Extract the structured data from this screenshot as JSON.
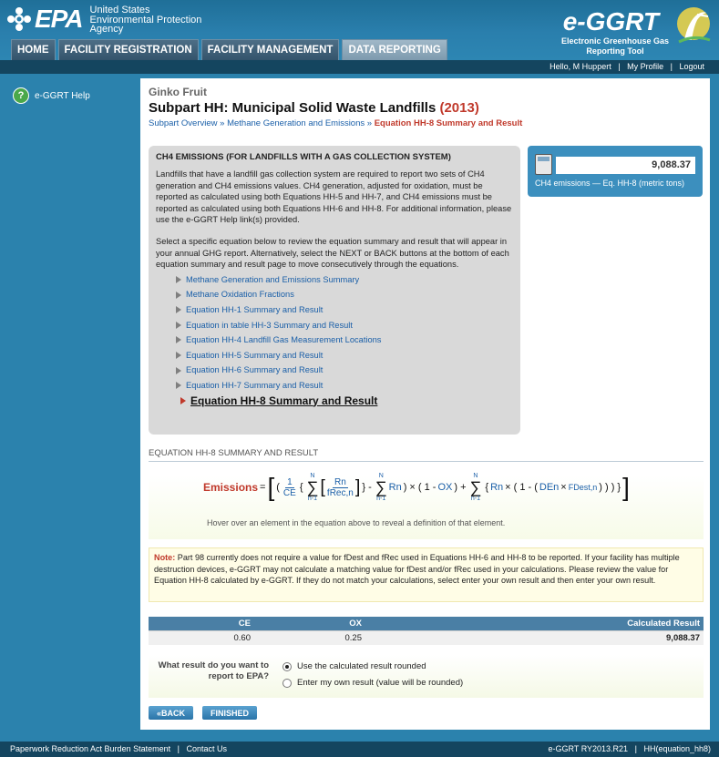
{
  "header": {
    "epa_word": "EPA",
    "epa_agency": [
      "United States",
      "Environmental Protection",
      "Agency"
    ],
    "eggrt_title": "e-GGRT",
    "eggrt_subtitle": [
      "Electronic Greenhouse Gas",
      "Reporting Tool"
    ]
  },
  "nav": {
    "tabs": [
      {
        "label": "HOME"
      },
      {
        "label": "FACILITY REGISTRATION"
      },
      {
        "label": "FACILITY MANAGEMENT"
      },
      {
        "label": "DATA REPORTING"
      }
    ]
  },
  "userbar": {
    "greeting": "Hello, M Huppert",
    "profile": "My Profile",
    "logout": "Logout"
  },
  "sidebar": {
    "help_label": "e-GGRT Help"
  },
  "page": {
    "facility": "Ginko Fruit",
    "title": "Subpart HH: Municipal Solid Waste Landfills",
    "year": "(2013)",
    "breadcrumb": {
      "item1": "Subpart Overview",
      "sep": "»",
      "item2": "Methane Generation and Emissions",
      "current": "Equation HH-8 Summary and Result"
    }
  },
  "info_box": {
    "heading": "CH4 EMISSIONS (FOR LANDFILLS WITH A GAS COLLECTION SYSTEM)",
    "para1": "Landfills that have a landfill gas collection system are required to report two sets of CH4 generation and CH4 emissions values. CH4 generation, adjusted for oxidation, must be reported as calculated using both Equations HH-5 and HH-7, and CH4 emissions must be reported as calculated using both Equations HH-6 and HH-8. For additional information, please use the e-GGRT Help link(s) provided.",
    "para2": "Select a specific equation below to review the equation summary and result that will appear in your annual GHG report. Alternatively, select the NEXT or BACK buttons at the bottom of each equation summary and result page to move consecutively through the equations.",
    "links": [
      "Methane Generation and Emissions Summary",
      "Methane Oxidation Fractions",
      "Equation HH-1 Summary and Result",
      "Equation in table HH-3 Summary and Result",
      "Equation HH-4 Landfill Gas Measurement Locations",
      "Equation HH-5 Summary and Result",
      "Equation HH-6 Summary and Result",
      "Equation HH-7 Summary and Result"
    ],
    "current_link": "Equation HH-8 Summary and Result"
  },
  "result_card": {
    "value": "9,088.37",
    "label": "CH4 emissions — Eq. HH-8 (metric tons)"
  },
  "equation": {
    "heading": "EQUATION HH-8 SUMMARY AND RESULT",
    "emissions": "Emissions",
    "one": "1",
    "ce": "CE",
    "rn": "Rn",
    "frec": "fRec,n",
    "ox": "OX",
    "de": "DEn",
    "fdest": "FDest,n",
    "sum_top": "N",
    "sum_bottom": "n-1",
    "hint": "Hover over an element in the equation above to reveal a definition of that element."
  },
  "note": {
    "label": "Note:",
    "text": "Part 98 currently does not require a value for fDest and fRec used in Equations HH-6 and HH-8 to be reported. If your facility has multiple destruction devices, e-GGRT may not calculate a matching value for fDest and/or fRec used in your calculations. Please review the value for Equation HH-8 calculated by e-GGRT. If they do not match your calculations, select enter your own result and then enter your own result."
  },
  "table": {
    "headers": [
      "CE",
      "OX",
      "Calculated Result"
    ],
    "row": [
      "0.60",
      "0.25",
      "9,088.37"
    ]
  },
  "choice": {
    "question": "What result do you want to report to EPA?",
    "opt1": "Use the calculated result rounded",
    "opt2": "Enter my own result (value will be rounded)"
  },
  "buttons": {
    "back": "«BACK",
    "finished": "FINISHED"
  },
  "footer": {
    "burden": "Paperwork Reduction Act Burden Statement",
    "contact": "Contact Us",
    "version": "e-GGRT RY2013.R21",
    "page_id": "HH(equation_hh8)"
  }
}
